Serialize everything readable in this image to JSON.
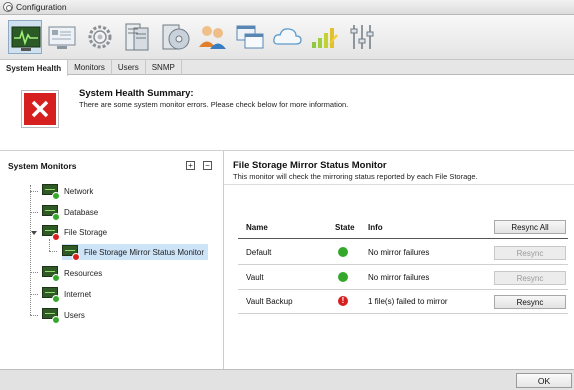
{
  "window": {
    "title": "Configuration"
  },
  "toolbar": {
    "icons": [
      "system-health-icon",
      "monitor-icon",
      "gear-icon",
      "server-icon",
      "storage-disk-icon",
      "users-icon",
      "windows-icon",
      "cloud-icon",
      "signal-bars-icon",
      "sliders-icon"
    ]
  },
  "tabs": [
    {
      "label": "System Health",
      "active": true
    },
    {
      "label": "Monitors",
      "active": false
    },
    {
      "label": "Users",
      "active": false
    },
    {
      "label": "SNMP",
      "active": false
    }
  ],
  "summary": {
    "title": "System Health Summary:",
    "description": "There are some system monitor errors. Please check below for more information."
  },
  "monitors": {
    "heading": "System Monitors",
    "expand_label": "+",
    "collapse_label": "−",
    "items": [
      {
        "label": "Network",
        "status": "ok"
      },
      {
        "label": "Database",
        "status": "ok"
      },
      {
        "label": "File Storage",
        "status": "error"
      },
      {
        "label": "File Storage Mirror Status Monitor",
        "status": "error"
      },
      {
        "label": "Resources",
        "status": "ok"
      },
      {
        "label": "Internet",
        "status": "ok"
      },
      {
        "label": "Users",
        "status": "ok"
      }
    ]
  },
  "detail": {
    "title": "File Storage Mirror Status Monitor",
    "description": "This monitor will check the mirroring status reported by each File Storage.",
    "columns": {
      "name": "Name",
      "state": "State",
      "info": "Info"
    },
    "resync_all_label": "Resync All",
    "rows": [
      {
        "name": "Default",
        "state": "ok",
        "info": "No mirror failures",
        "button": "Resync",
        "enabled": false
      },
      {
        "name": "Vault",
        "state": "ok",
        "info": "No mirror failures",
        "button": "Resync",
        "enabled": false
      },
      {
        "name": "Vault Backup",
        "state": "error",
        "info": "1 file(s) failed to mirror",
        "button": "Resync",
        "enabled": true
      }
    ]
  },
  "footer": {
    "ok_label": "OK"
  },
  "colors": {
    "error": "#d62020",
    "ok": "#35a82c",
    "selection": "#cde3f7"
  }
}
